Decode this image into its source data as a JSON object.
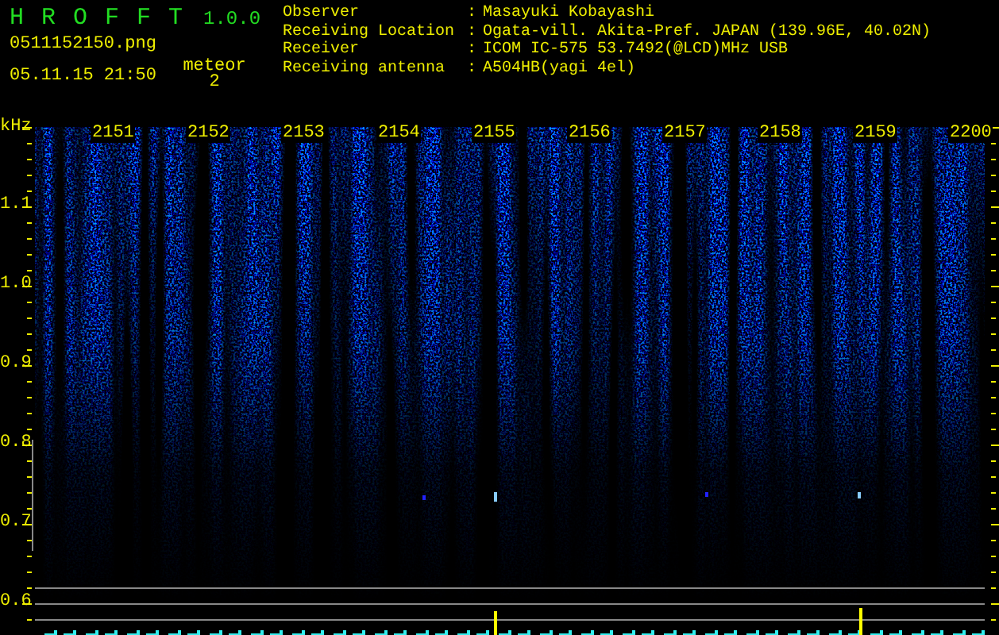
{
  "app": {
    "name": "H R O F F T",
    "version": "1.0.0"
  },
  "file": {
    "filename": "0511152150.png",
    "timestamp": "05.11.15 21:50"
  },
  "meteor": {
    "label": "meteor",
    "count": "2"
  },
  "info": [
    {
      "label": "Observer",
      "separator": ":",
      "value": "Masayuki Kobayashi"
    },
    {
      "label": "Receiving Location",
      "separator": ":",
      "value": "Ogata-vill. Akita-Pref. JAPAN (139.96E, 40.02N)"
    },
    {
      "label": "Receiver",
      "separator": ":",
      "value": "ICOM IC-575 53.7492(@LCD)MHz USB"
    },
    {
      "label": "Receiving antenna",
      "separator": ":",
      "value": "A504HB(yagi 4el)"
    }
  ],
  "plot": {
    "y_unit": "kHz",
    "y_labels": [
      "1.1",
      "1.0",
      "0.9",
      "0.8",
      "0.7",
      "0.6"
    ],
    "time_labels": [
      "2151",
      "2152",
      "2153",
      "2154",
      "2155",
      "2156",
      "2157",
      "2158",
      "2159",
      "2200"
    ]
  }
}
